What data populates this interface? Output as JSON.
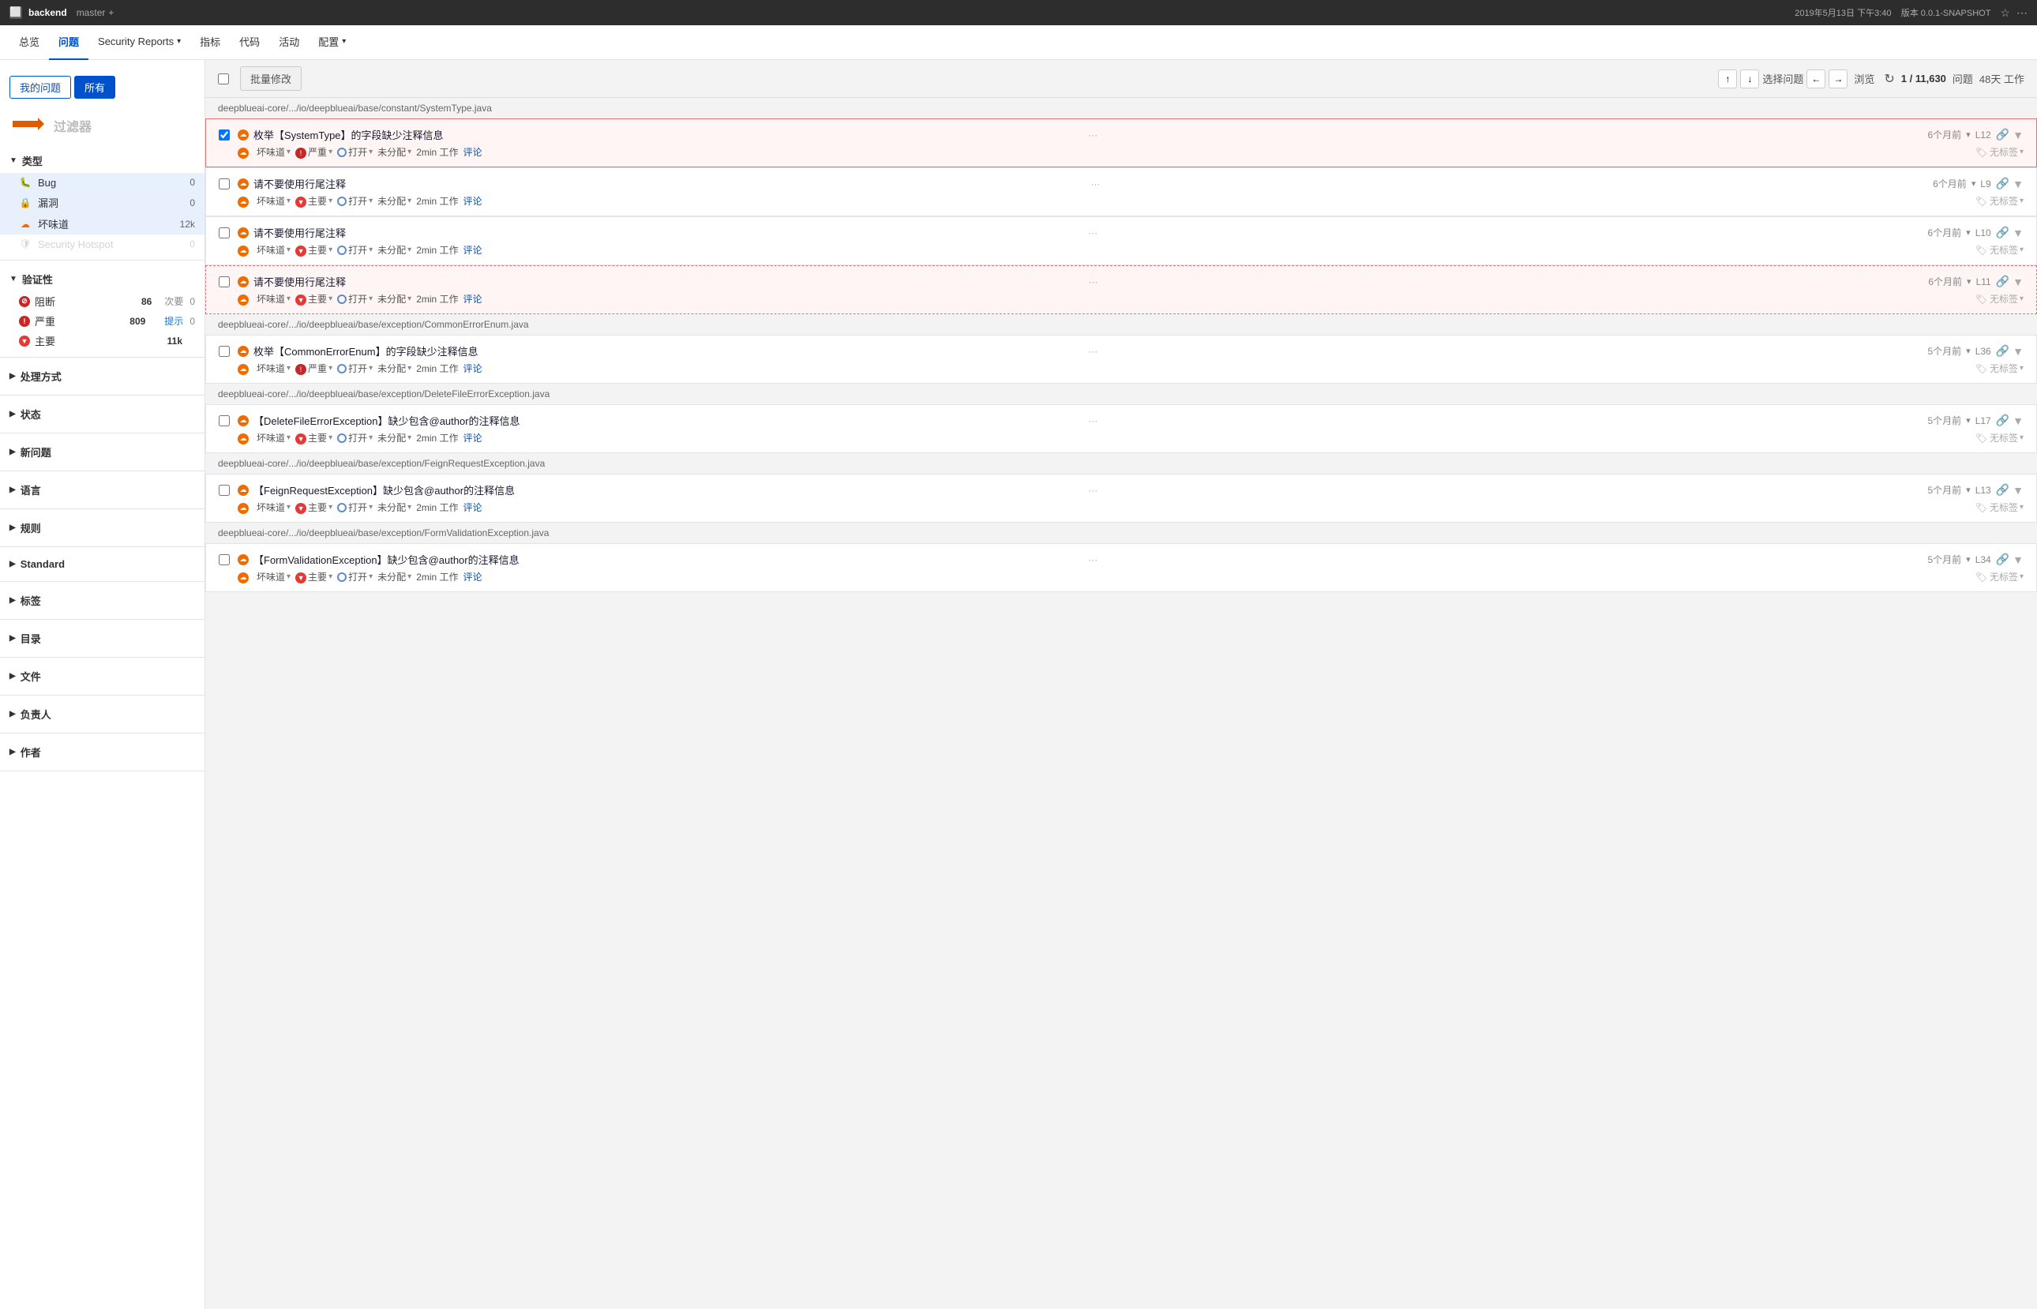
{
  "topbar": {
    "logo": "⬛",
    "title": "backend",
    "branch": "master",
    "plus": "+",
    "datetime": "2019年5月13日 下午3:40",
    "version": "版本 0.0.1-SNAPSHOT"
  },
  "navbar": {
    "items": [
      {
        "label": "总览",
        "active": false
      },
      {
        "label": "问题",
        "active": true
      },
      {
        "label": "Security Reports",
        "active": false,
        "dropdown": true
      },
      {
        "label": "指标",
        "active": false
      },
      {
        "label": "代码",
        "active": false
      },
      {
        "label": "活动",
        "active": false
      },
      {
        "label": "配置",
        "active": false,
        "dropdown": true
      }
    ]
  },
  "filter_tabs": {
    "my_issues": "我的问题",
    "all": "所有"
  },
  "filter_label": "过滤器",
  "filter_arrow_label": "←",
  "sidebar": {
    "type_section": "类型",
    "types": [
      {
        "icon": "bug",
        "label": "Bug",
        "count": "0",
        "selected": true
      },
      {
        "icon": "lock",
        "label": "漏洞",
        "count": "0",
        "selected": true
      },
      {
        "icon": "smell",
        "label": "坏味道",
        "count": "12k",
        "selected": true
      },
      {
        "icon": "shield",
        "label": "Security Hotspot",
        "count": "0",
        "disabled": true
      }
    ],
    "verify_section": "验证性",
    "severities": [
      {
        "dot_color": "#c62828",
        "label": "阻断",
        "count": "86",
        "sec_label": "次要",
        "sec_count": "0"
      },
      {
        "dot_color": "#c62828",
        "label": "严重",
        "count": "809",
        "sec_label": "提示",
        "sec_count": "0"
      },
      {
        "dot_color": "#e53935",
        "label": "主要",
        "count": "11k",
        "sec_label": "",
        "sec_count": ""
      }
    ],
    "sections": [
      "处理方式",
      "状态",
      "新问题",
      "语言",
      "规则",
      "Standard",
      "标签",
      "目录",
      "文件",
      "负责人",
      "作者"
    ]
  },
  "toolbar": {
    "bulk_modify": "批量修改",
    "select_issue": "选择问题",
    "browse": "浏览",
    "count_current": "1",
    "count_total": "11,630",
    "count_label": "问题",
    "days_label": "48天 工作"
  },
  "issues": [
    {
      "file_path": "deepblueai-core/.../io/deepblueai/base/constant/SystemType.java",
      "items": [
        {
          "title": "枚举【SystemType】的字段缺少注释信息",
          "extra": "···",
          "selected": true,
          "type": "smell",
          "severity": "严重",
          "status": "打开",
          "assign": "未分配",
          "effort": "2min 工作",
          "comment": "评论",
          "meta_time": "6个月前",
          "meta_line": "L12",
          "no_tag": "无标签"
        },
        {
          "title": "请不要使用行尾注释",
          "extra": "···",
          "selected": false,
          "type": "smell",
          "severity": "主要",
          "status": "打开",
          "assign": "未分配",
          "effort": "2min 工作",
          "comment": "评论",
          "meta_time": "6个月前",
          "meta_line": "L9",
          "no_tag": "无标签"
        },
        {
          "title": "请不要使用行尾注释",
          "extra": "···",
          "selected": false,
          "type": "smell",
          "severity": "主要",
          "status": "打开",
          "assign": "未分配",
          "effort": "2min 工作",
          "comment": "评论",
          "meta_time": "6个月前",
          "meta_line": "L10",
          "no_tag": "无标签"
        },
        {
          "title": "请不要使用行尾注释",
          "extra": "···",
          "selected": false,
          "dashed": true,
          "type": "smell",
          "severity": "主要",
          "status": "打开",
          "assign": "未分配",
          "effort": "2min 工作",
          "comment": "评论",
          "meta_time": "6个月前",
          "meta_line": "L11",
          "no_tag": "无标签"
        }
      ]
    },
    {
      "file_path": "deepblueai-core/.../io/deepblueai/base/exception/CommonErrorEnum.java",
      "items": [
        {
          "title": "枚举【CommonErrorEnum】的字段缺少注释信息",
          "extra": "···",
          "selected": false,
          "type": "smell",
          "severity": "严重",
          "status": "打开",
          "assign": "未分配",
          "effort": "2min 工作",
          "comment": "评论",
          "meta_time": "5个月前",
          "meta_line": "L36",
          "no_tag": "无标签"
        }
      ]
    },
    {
      "file_path": "deepblueai-core/.../io/deepblueai/base/exception/DeleteFileErrorException.java",
      "items": [
        {
          "title": "【DeleteFileErrorException】缺少包含@author的注释信息",
          "extra": "···",
          "selected": false,
          "type": "smell",
          "severity": "主要",
          "status": "打开",
          "assign": "未分配",
          "effort": "2min 工作",
          "comment": "评论",
          "meta_time": "5个月前",
          "meta_line": "L17",
          "no_tag": "无标签"
        }
      ]
    },
    {
      "file_path": "deepblueai-core/.../io/deepblueai/base/exception/FeignRequestException.java",
      "items": [
        {
          "title": "【FeignRequestException】缺少包含@author的注释信息",
          "extra": "···",
          "selected": false,
          "type": "smell",
          "severity": "主要",
          "status": "打开",
          "assign": "未分配",
          "effort": "2min 工作",
          "comment": "评论",
          "meta_time": "5个月前",
          "meta_line": "L13",
          "no_tag": "无标签"
        }
      ]
    },
    {
      "file_path": "deepblueai-core/.../io/deepblueai/base/exception/FormValidationException.java",
      "items": [
        {
          "title": "【FormValidationException】缺少包含@author的注释信息",
          "extra": "···",
          "selected": false,
          "type": "smell",
          "severity": "主要",
          "status": "打开",
          "assign": "未分配",
          "effort": "2min 工作",
          "comment": "评论",
          "meta_time": "5个月前",
          "meta_line": "L34",
          "no_tag": "无标签"
        }
      ]
    }
  ]
}
